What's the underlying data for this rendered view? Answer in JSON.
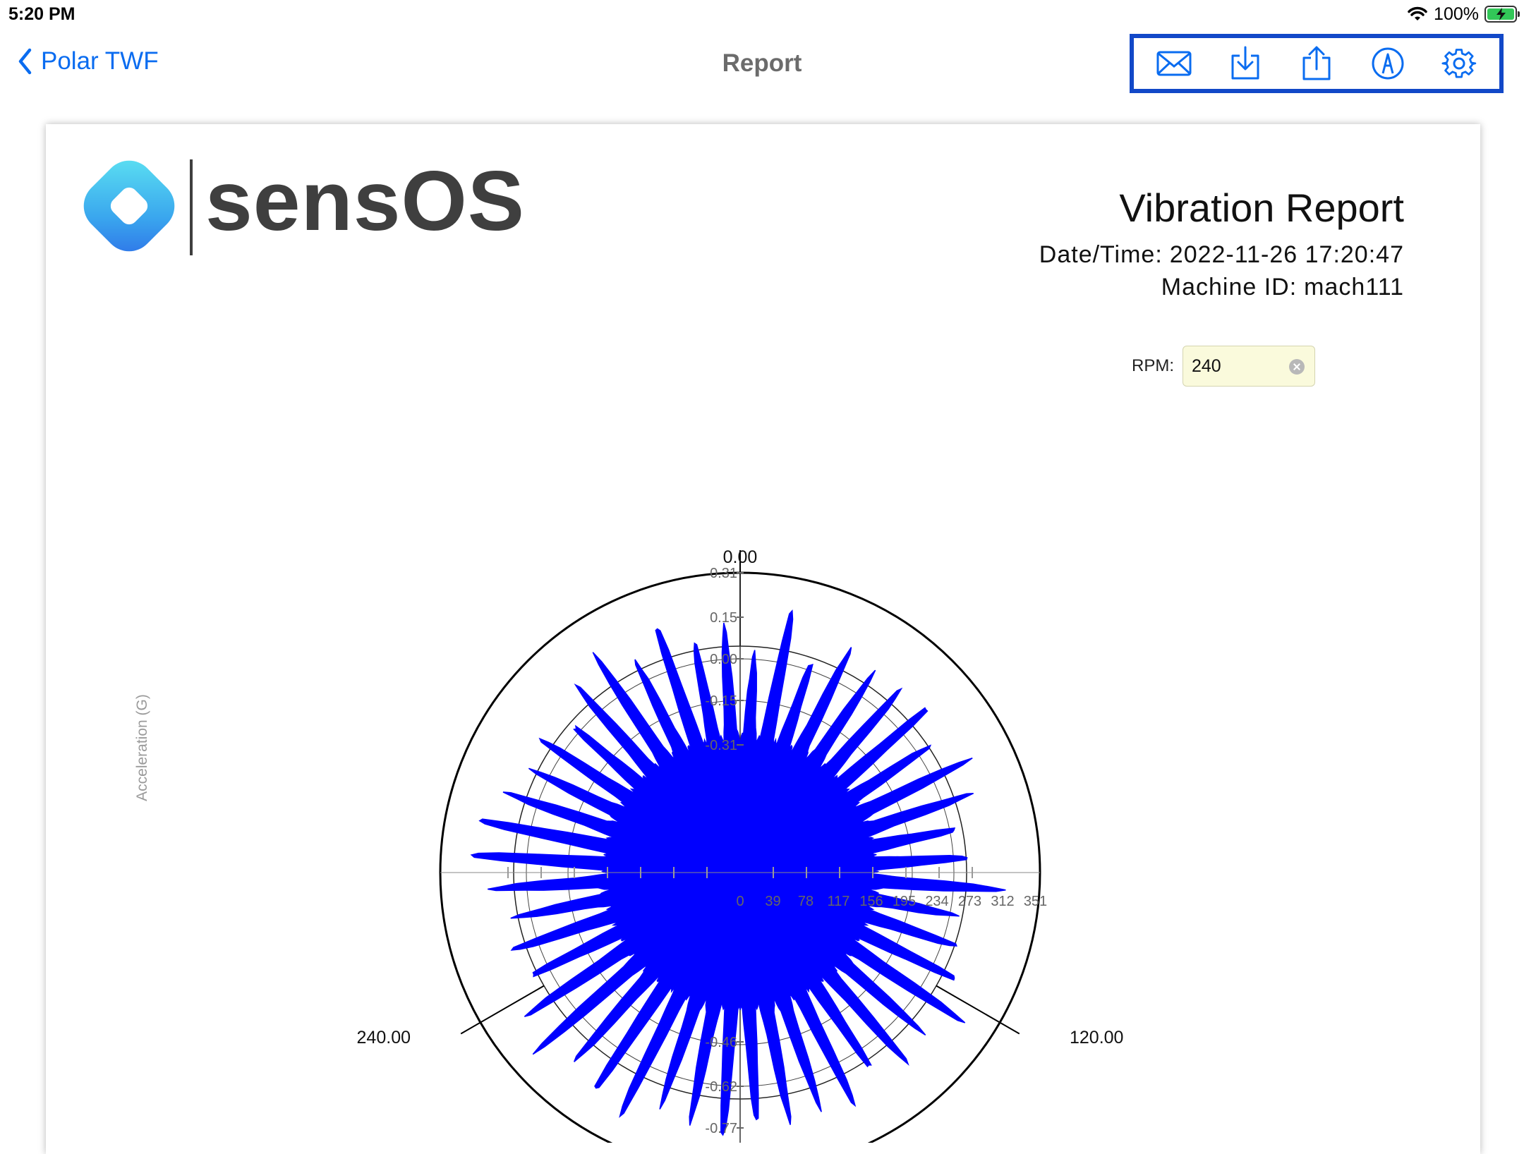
{
  "status_bar": {
    "time": "5:20 PM",
    "battery_percent": "100%",
    "battery_charging": true,
    "icons": [
      "wifi-icon",
      "battery-charging-icon"
    ]
  },
  "nav": {
    "back_label": "Polar TWF",
    "title": "Report",
    "toolbar": [
      {
        "name": "mail-button",
        "icon": "envelope-icon"
      },
      {
        "name": "download-button",
        "icon": "download-tray-icon"
      },
      {
        "name": "share-button",
        "icon": "share-icon"
      },
      {
        "name": "markup-button",
        "icon": "pen-markup-icon"
      },
      {
        "name": "settings-button",
        "icon": "gear-icon"
      }
    ],
    "accent_color": "#0A6CF0",
    "toolbar_highlight_color": "#1248C8"
  },
  "report": {
    "logo_text": "sensOS",
    "title": "Vibration Report",
    "date_label": "Date/Time:",
    "date_value": "2022-11-26 17:20:47",
    "machine_label": "Machine ID:",
    "machine_value": "mach111"
  },
  "rpm": {
    "label": "RPM:",
    "value": "240"
  },
  "chart_data": {
    "type": "polar",
    "y_axis_title": "Acceleration (G)",
    "angle_labels": [
      "0.00",
      "120.00",
      "240.00"
    ],
    "radial_tick_labels": [
      "0.31",
      "0.15",
      "0.00",
      "-0.15",
      "-0.31",
      "-0.46",
      "-0.62",
      "-0.77"
    ],
    "radial_range": [
      -0.77,
      0.31
    ],
    "inner_x_tick_labels": [
      "0",
      "39",
      "78",
      "117",
      "156",
      "195",
      "234",
      "273",
      "312",
      "351"
    ],
    "series": [
      {
        "color": "#0000FF",
        "lobe_count": 48,
        "lobe_peak_range": [
          0.0,
          0.19
        ],
        "baseline": -0.31
      }
    ]
  }
}
